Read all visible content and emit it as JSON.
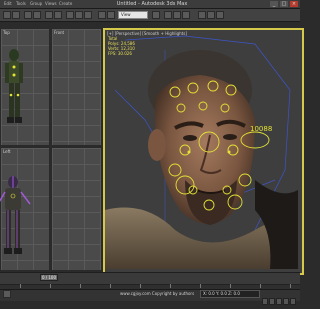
{
  "titlebar": {
    "title": "Untitled - Autodesk 3ds Max",
    "menu": [
      "Edit",
      "Tools",
      "Group",
      "Views",
      "Create",
      "Modifiers",
      "Animation"
    ],
    "minimize": "_",
    "maximize": "□",
    "close": "×"
  },
  "toolbar": {
    "view_dropdown": "View"
  },
  "viewports": {
    "front_label": "Front",
    "left_label": "Left",
    "top_label": "Top",
    "perspective_label": "[+] [Perspective] [Smooth + Highlights]"
  },
  "stats": {
    "lines": "Total\nPolys: 24,586\nVerts: 12,310\nFPS: 30.026"
  },
  "rig_label": "10088",
  "timeline": {
    "frame": "0 / 100"
  },
  "statusbar": {
    "text": "www.cgjoy.com  Copyright by authors",
    "coords": "X: 0.0  Y: 0.0  Z: 0.0"
  },
  "colors": {
    "selection_border": "#d4c94a",
    "rig_control": "#e3e236",
    "stats_text": "#e8e05a",
    "close_button": "#b33a2c"
  }
}
